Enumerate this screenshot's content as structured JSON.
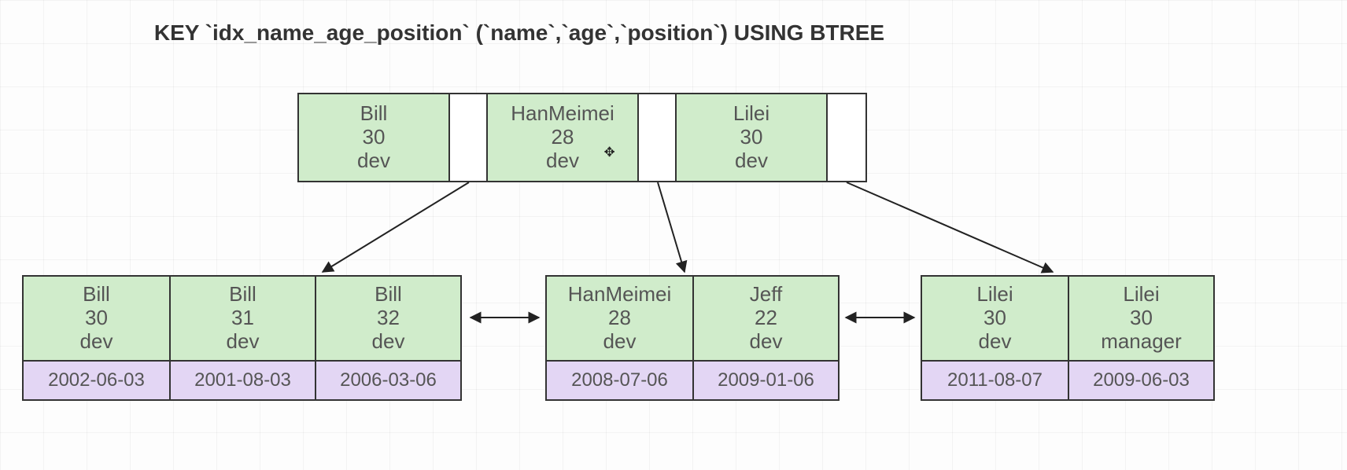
{
  "title": "KEY `idx_name_age_position` (`name`,`age`,`position`) USING BTREE",
  "root": {
    "keys": [
      {
        "name": "Bill",
        "age": "30",
        "position": "dev"
      },
      {
        "name": "HanMeimei",
        "age": "28",
        "position": "dev"
      },
      {
        "name": "Lilei",
        "age": "30",
        "position": "dev"
      }
    ]
  },
  "leaves": [
    {
      "entries": [
        {
          "name": "Bill",
          "age": "30",
          "position": "dev",
          "value": "2002-06-03"
        },
        {
          "name": "Bill",
          "age": "31",
          "position": "dev",
          "value": "2001-08-03"
        },
        {
          "name": "Bill",
          "age": "32",
          "position": "dev",
          "value": "2006-03-06"
        }
      ]
    },
    {
      "entries": [
        {
          "name": "HanMeimei",
          "age": "28",
          "position": "dev",
          "value": "2008-07-06"
        },
        {
          "name": "Jeff",
          "age": "22",
          "position": "dev",
          "value": "2009-01-06"
        }
      ]
    },
    {
      "entries": [
        {
          "name": "Lilei",
          "age": "30",
          "position": "dev",
          "value": "2011-08-07"
        },
        {
          "name": "Lilei",
          "age": "30",
          "position": "manager",
          "value": "2009-06-03"
        }
      ]
    }
  ],
  "colors": {
    "key_bg": "#d0eccb",
    "value_bg": "#e3d6f4",
    "border": "#333333"
  },
  "cursor_icon": "move-cursor-icon"
}
